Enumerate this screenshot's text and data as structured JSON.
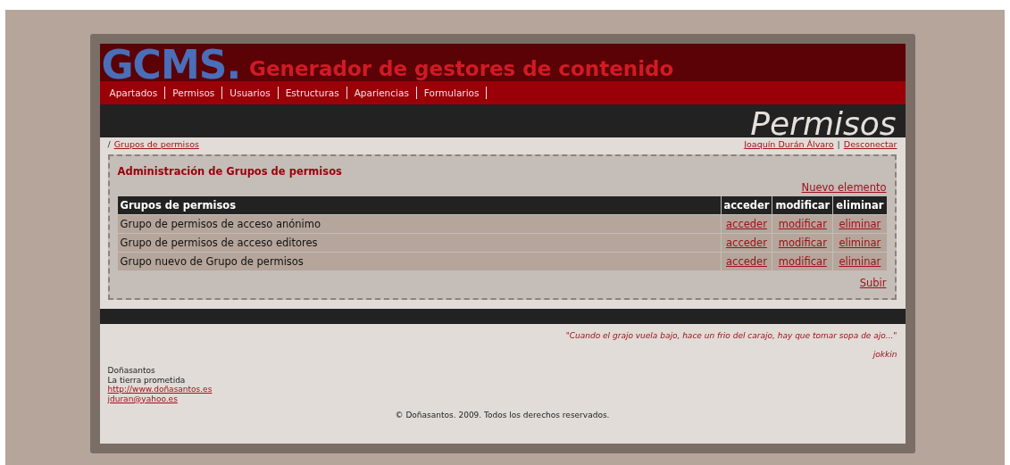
{
  "header": {
    "logo": "GCMS.",
    "tagline": "Generador de gestores de contenido"
  },
  "nav": {
    "items": [
      "Apartados",
      "Permisos",
      "Usuarios",
      "Estructuras",
      "Apariencias",
      "Formularios"
    ]
  },
  "section_title": "Permisos",
  "breadcrumb": {
    "separator": "/",
    "link": "Grupos de permisos"
  },
  "user": {
    "name": "Joaquín Durán Álvaro",
    "separator": "|",
    "logout": "Desconectar"
  },
  "panel": {
    "title": "Administración de Grupos de permisos",
    "new_link": "Nuevo elemento",
    "up_link": "Subir",
    "table": {
      "columns": [
        "Grupos de permisos",
        "acceder",
        "modificar",
        "eliminar"
      ],
      "rows": [
        {
          "name": "Grupo de permisos de acceso anónimo",
          "actions": [
            "acceder",
            "modificar",
            "eliminar"
          ]
        },
        {
          "name": "Grupo de permisos de acceso editores",
          "actions": [
            "acceder",
            "modificar",
            "eliminar"
          ]
        },
        {
          "name": "Grupo nuevo de Grupo de permisos",
          "actions": [
            "acceder",
            "modificar",
            "eliminar"
          ]
        }
      ]
    }
  },
  "footer": {
    "quote": "\"Cuando el grajo vuela bajo, hace un frio del carajo, hay que tomar sopa de ajo...\"",
    "quote_author": "jokkin",
    "contact": [
      {
        "kind": "text",
        "value": "Doñasantos"
      },
      {
        "kind": "text",
        "value": "La tierra prometida"
      },
      {
        "kind": "link",
        "value": "http://www.doñasantos.es"
      },
      {
        "kind": "link",
        "value": "jduran@yahoo.es"
      }
    ],
    "copyright": "© Doñasantos. 2009. Todos los derechos reservados."
  }
}
